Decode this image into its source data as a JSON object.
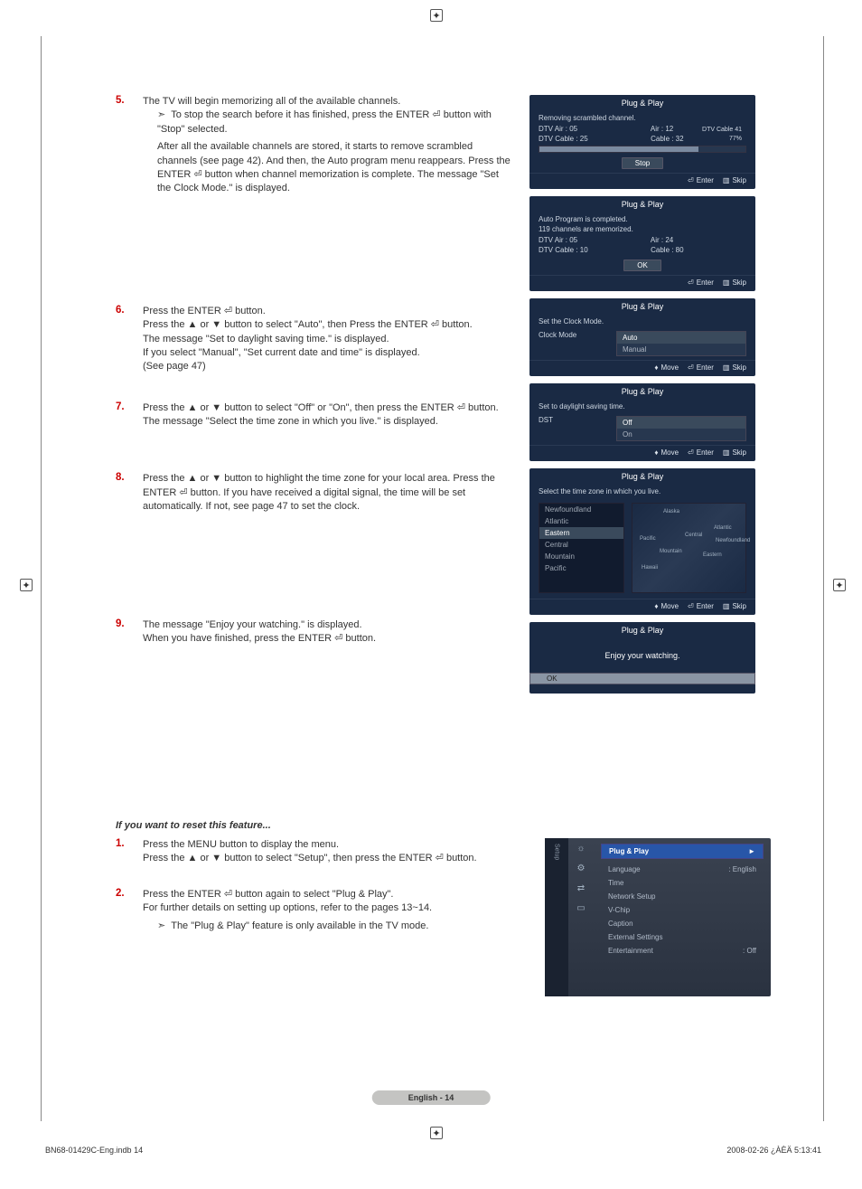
{
  "steps": {
    "s5_line1": "The TV will begin memorizing all of the available channels.",
    "s5_bullet": "To stop the search before it has finished, press the ENTER ⏎ button with \"Stop\" selected.",
    "s5_after": "After all the available channels are stored, it starts to remove scrambled channels (see page 42). And then, the Auto program menu reappears. Press the ENTER ⏎ button when channel memorization is complete. The message \"Set the Clock Mode.\" is displayed.",
    "s6_line1": "Press the ENTER ⏎ button.",
    "s6_line2": "Press the ▲ or ▼ button to select \"Auto\", then Press the ENTER ⏎ button.",
    "s6_line3": "The message \"Set to daylight saving time.\" is displayed.",
    "s6_line4": "If you select \"Manual\", \"Set current date and time\" is displayed.",
    "s6_line5": "(See page 47)",
    "s7_text": "Press the ▲ or ▼ button to select \"Off\" or \"On\", then press the ENTER ⏎ button. The message \"Select the time zone in which you live.\" is displayed.",
    "s8_text": "Press the ▲ or ▼ button to highlight the time zone for your local area. Press the ENTER ⏎ button. If you have received a digital signal, the time will be set automatically. If not, see page 47 to set the clock.",
    "s9_line1": "The message \"Enjoy your watching.\" is displayed.",
    "s9_line2": "When you have finished, press the ENTER ⏎ button."
  },
  "reset": {
    "heading": "If you want to reset this feature...",
    "r1_line1": "Press the MENU button to display the menu.",
    "r1_line2": "Press the ▲ or ▼ button to select \"Setup\", then press the ENTER ⏎ button.",
    "r2_line1": "Press the ENTER ⏎ button again to select \"Plug & Play\".",
    "r2_line2": "For further details on setting up options, refer to the pages 13~14.",
    "r2_bullet": "The \"Plug & Play\" feature is only available in the TV mode."
  },
  "osd1": {
    "title": "Plug & Play",
    "sub": "Removing scrambled channel.",
    "l1a": "DTV Air : 05",
    "l1b": "Air : 12",
    "l2a": "DTV Cable : 25",
    "l2b": "Cable : 32",
    "cable": "DTV Cable 41",
    "pct": "77%",
    "stop": "Stop",
    "enter": "Enter",
    "skip": "Skip"
  },
  "osd2": {
    "title": "Plug & Play",
    "line1": "Auto Program is completed.",
    "line2": "119 channels are memorized.",
    "line3a": "DTV Air : 05",
    "line3b": "Air : 24",
    "line4a": "DTV Cable : 10",
    "line4b": "Cable : 80",
    "ok": "OK",
    "enter": "Enter",
    "skip": "Skip"
  },
  "osd3": {
    "title": "Plug & Play",
    "sub": "Set the Clock Mode.",
    "label": "Clock Mode",
    "opt1": "Auto",
    "opt2": "Manual",
    "move": "Move",
    "enter": "Enter",
    "skip": "Skip"
  },
  "osd4": {
    "title": "Plug & Play",
    "sub": "Set to daylight saving time.",
    "label": "DST",
    "opt1": "Off",
    "opt2": "On",
    "move": "Move",
    "enter": "Enter",
    "skip": "Skip"
  },
  "osd5": {
    "title": "Plug & Play",
    "sub": "Select the time zone in which you live.",
    "tz": [
      "Newfoundland",
      "Atlantic",
      "Eastern",
      "Central",
      "Mountain",
      "Pacific"
    ],
    "map": [
      "Alaska",
      "Pacific",
      "Mountain",
      "Central",
      "Hawaii",
      "Eastern",
      "Atlantic",
      "Newfoundland"
    ],
    "move": "Move",
    "enter": "Enter",
    "skip": "Skip"
  },
  "osd6": {
    "title": "Plug & Play",
    "msg": "Enjoy your watching.",
    "ok": "OK"
  },
  "setup": {
    "side": "Setup",
    "highlight": "Plug & Play",
    "items": [
      {
        "k": "Language",
        "v": ": English"
      },
      {
        "k": "Time",
        "v": ""
      },
      {
        "k": "Network Setup",
        "v": ""
      },
      {
        "k": "V-Chip",
        "v": ""
      },
      {
        "k": "Caption",
        "v": ""
      },
      {
        "k": "External Settings",
        "v": ""
      },
      {
        "k": "Entertainment",
        "v": ": Off"
      }
    ]
  },
  "footer": {
    "page": "English - 14",
    "doc_left": "BN68-01429C-Eng.indb   14",
    "doc_right": "2008-02-26   ¿ÀÈÄ 5:13:41"
  }
}
